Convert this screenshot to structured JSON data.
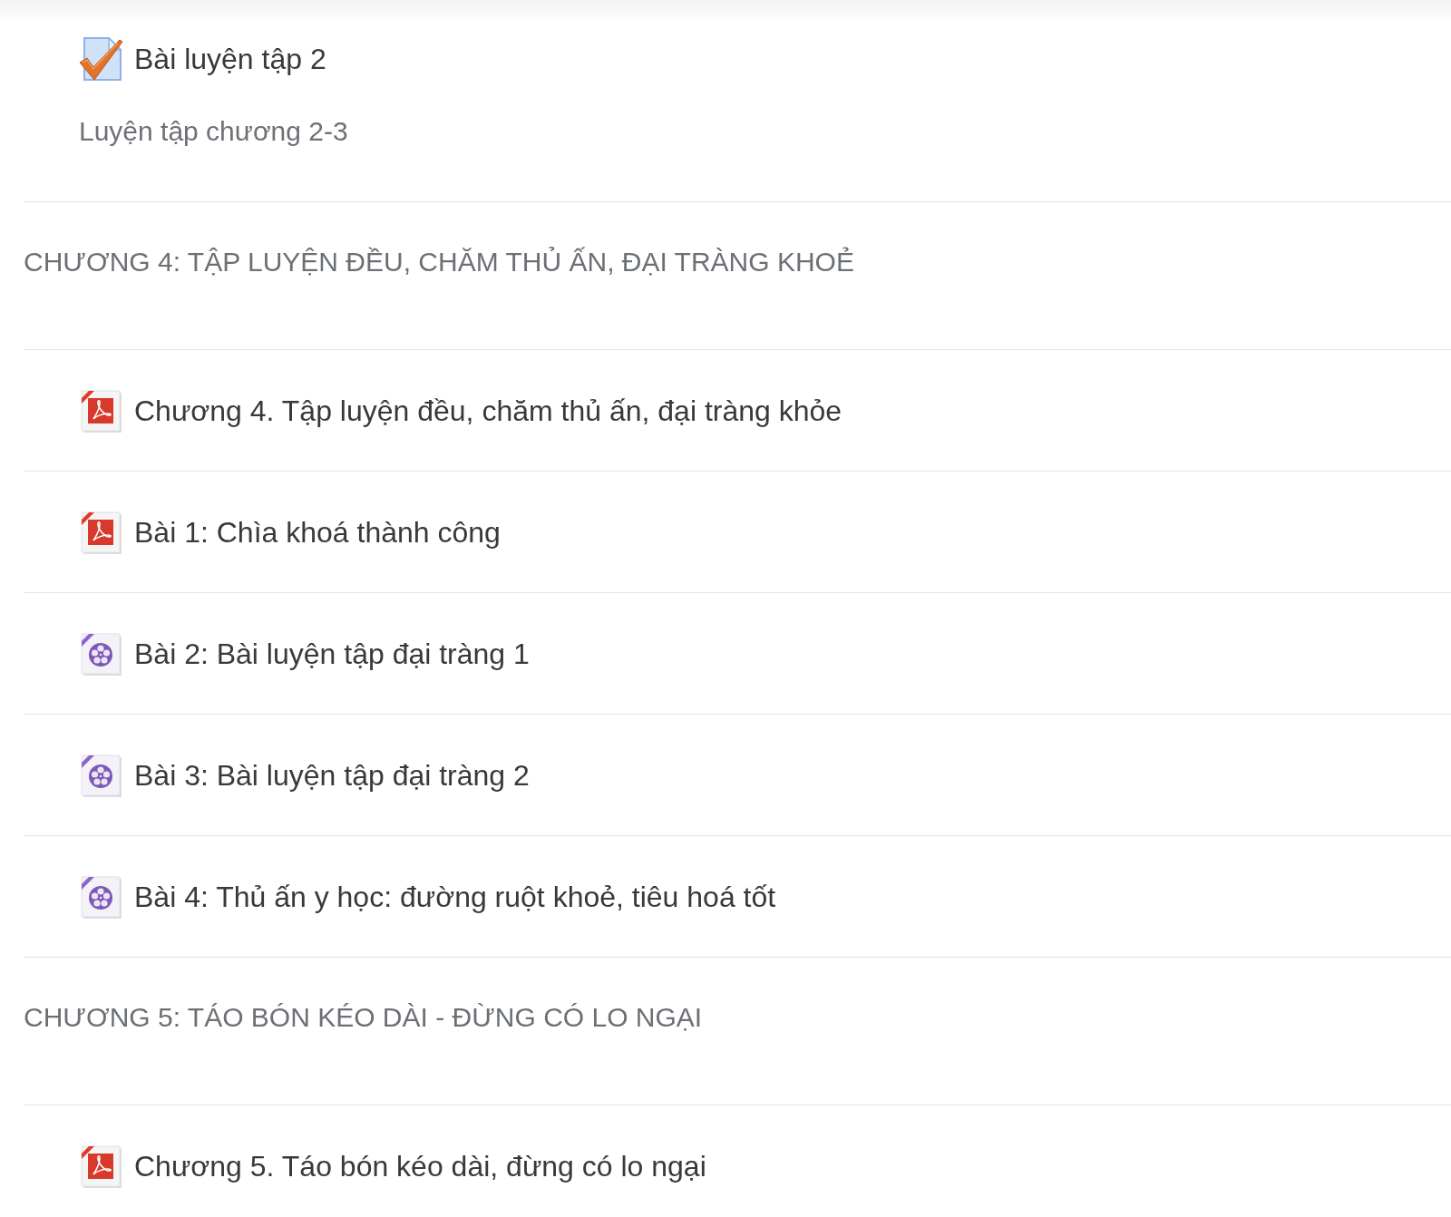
{
  "sections": [
    {
      "items": [
        {
          "kind": "quiz",
          "title": "Bài luyện tập 2",
          "description": "Luyện tập chương 2-3"
        }
      ]
    },
    {
      "title": "CHƯƠNG 4: TẬP LUYỆN ĐỀU, CHĂM THỦ ẤN, ĐẠI TRÀNG KHOẺ",
      "items": [
        {
          "kind": "pdf",
          "title": "Chương 4. Tập luyện đều, chăm thủ ấn, đại tràng khỏe"
        },
        {
          "kind": "pdf",
          "title": "Bài 1: Chìa khoá thành công"
        },
        {
          "kind": "video",
          "title": "Bài 2: Bài luyện tập đại tràng 1"
        },
        {
          "kind": "video",
          "title": "Bài 3: Bài luyện tập đại tràng 2"
        },
        {
          "kind": "video",
          "title": "Bài 4: Thủ ấn y học: đường ruột khoẻ, tiêu hoá tốt"
        }
      ]
    },
    {
      "title": "CHƯƠNG 5: TÁO BÓN KÉO DÀI - ĐỪNG CÓ LO NGẠI",
      "items": [
        {
          "kind": "pdf",
          "title": "Chương 5. Táo bón kéo dài, đừng có lo ngại"
        }
      ]
    }
  ]
}
